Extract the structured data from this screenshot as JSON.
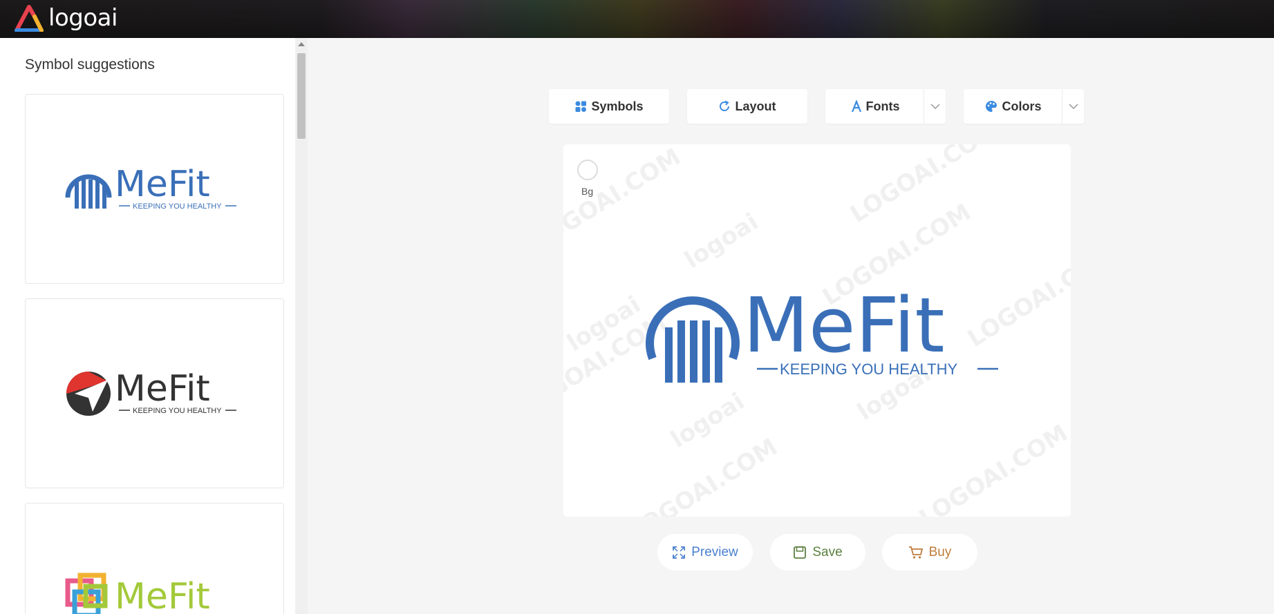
{
  "app": {
    "name": "logoai"
  },
  "sidebar": {
    "title": "Symbol suggestions",
    "cards": [
      {
        "brand": "MeFit",
        "tagline": "KEEPING YOU HEALTHY",
        "symbol": "arc-bars-icon",
        "color": "#3a6fb8"
      },
      {
        "brand": "MeFit",
        "tagline": "KEEPING YOU HEALTHY",
        "symbol": "paper-plane-circle-icon",
        "color": "#333333",
        "accent": "#e0342e"
      },
      {
        "brand": "MeFit",
        "symbol": "interlocked-squares-icon",
        "color": "#a3c93a"
      }
    ]
  },
  "toolbar": {
    "symbols_label": "Symbols",
    "layout_label": "Layout",
    "fonts_label": "Fonts",
    "colors_label": "Colors"
  },
  "canvas": {
    "bg_label": "Bg",
    "brand": "MeFit",
    "tagline": "KEEPING YOU HEALTHY",
    "brand_color": "#3a6fb8",
    "watermarks": [
      "logoai",
      "LOGOAI.COM"
    ]
  },
  "actions": {
    "preview_label": "Preview",
    "save_label": "Save",
    "buy_label": "Buy"
  }
}
